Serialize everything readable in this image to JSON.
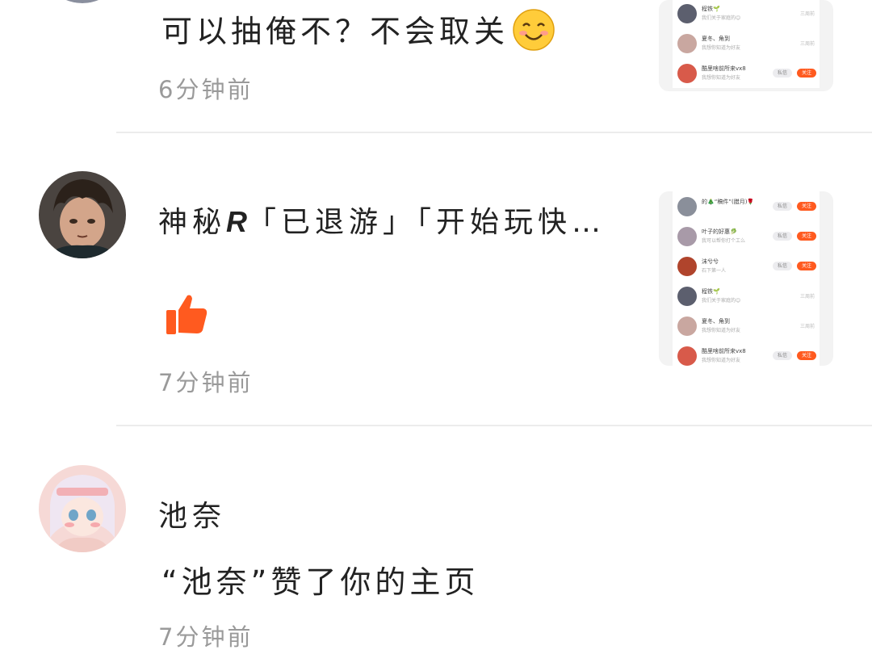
{
  "notifications": [
    {
      "body": "可以抽俺不？不会取关",
      "time": "6分钟前",
      "has_emoji": true
    },
    {
      "name_prefix": "神秘",
      "name_bold": "R",
      "name_suffix": "「已退游」「开始玩快…",
      "time": "7分钟前"
    },
    {
      "name": "池奈",
      "body": "“池奈”赞了你的主页",
      "time": "7分钟前"
    }
  ],
  "thumbnail_rows": [
    {
      "name": "的🎄“稿件”(腊月)🌹",
      "sub": "",
      "btn1": "私信",
      "btn2": "关注"
    },
    {
      "name": "叶子的好惠🥬",
      "sub": "我可以帮你打个工么",
      "btn1": "私信",
      "btn2": "关注"
    },
    {
      "name": "沫兮兮",
      "sub": "石下第一人",
      "btn1": "私信",
      "btn2": "关注"
    },
    {
      "name": "程铁🌱",
      "sub": "我们关于家庭的😊",
      "date": "三周前"
    },
    {
      "name": "夏冬、角到",
      "sub": "我想你知道为好友",
      "date": "三周前"
    },
    {
      "name": "酷里啥前所来vx8",
      "sub": "我想你知道为好友",
      "btn1": "私信",
      "btn2": "关注"
    }
  ],
  "colors": {
    "accent": "#ff5a1f",
    "time_gray": "#9a9a9a",
    "divider": "#ececec"
  }
}
